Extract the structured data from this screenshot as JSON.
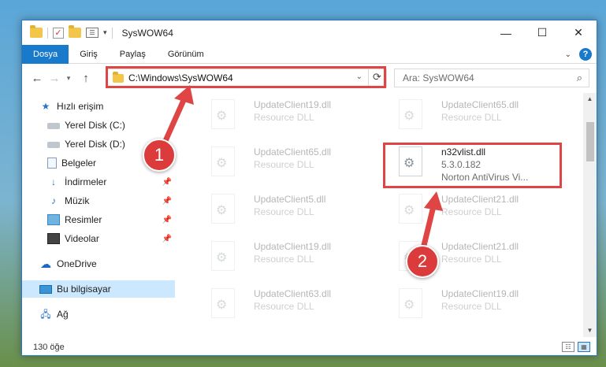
{
  "window": {
    "title": "SysWOW64"
  },
  "ribbon": {
    "tabs": [
      "Dosya",
      "Giriş",
      "Paylaş",
      "Görünüm"
    ]
  },
  "address": {
    "path": "C:\\Windows\\SysWOW64"
  },
  "search": {
    "placeholder": "Ara: SysWOW64"
  },
  "sidebar": {
    "items": [
      {
        "label": "Hızlı erişim",
        "icon": "star-icon",
        "pinned": false
      },
      {
        "label": "Yerel Disk (C:)",
        "icon": "disk-icon",
        "pinned": true
      },
      {
        "label": "Yerel Disk (D:)",
        "icon": "disk-icon",
        "pinned": true
      },
      {
        "label": "Belgeler",
        "icon": "document-icon",
        "pinned": true
      },
      {
        "label": "İndirmeler",
        "icon": "download-icon",
        "pinned": true
      },
      {
        "label": "Müzik",
        "icon": "music-icon",
        "pinned": true
      },
      {
        "label": "Resimler",
        "icon": "pictures-icon",
        "pinned": true
      },
      {
        "label": "Videolar",
        "icon": "videos-icon",
        "pinned": true
      },
      {
        "label": "OneDrive",
        "icon": "cloud-icon",
        "pinned": false
      },
      {
        "label": "Bu bilgisayar",
        "icon": "computer-icon",
        "pinned": false
      },
      {
        "label": "Ağ",
        "icon": "network-icon",
        "pinned": false
      }
    ]
  },
  "files": {
    "left": [
      {
        "name": "UpdateClient19.dll",
        "type": "Resource DLL"
      },
      {
        "name": "UpdateClient65.dll",
        "type": "Resource DLL"
      },
      {
        "name": "UpdateClient5.dll",
        "type": "Resource DLL"
      },
      {
        "name": "UpdateClient19.dll",
        "type": "Resource DLL"
      },
      {
        "name": "UpdateClient63.dll",
        "type": "Resource DLL"
      }
    ],
    "right": [
      {
        "name": "UpdateClient65.dll",
        "type": "Resource DLL"
      },
      {
        "name": "UpdateClient21.dll",
        "type": "Resource DLL"
      },
      {
        "name": "UpdateClient21.dll",
        "type": "Resource DLL"
      },
      {
        "name": "UpdateClient19.dll",
        "type": "Resource DLL"
      }
    ],
    "highlighted": {
      "name": "n32vlist.dll",
      "version": "5.3.0.182",
      "description": "Norton AntiVirus Vi..."
    }
  },
  "status": {
    "item_count": "130 öğe"
  },
  "annotations": {
    "step1": "1",
    "step2": "2",
    "color": "#e04545"
  }
}
